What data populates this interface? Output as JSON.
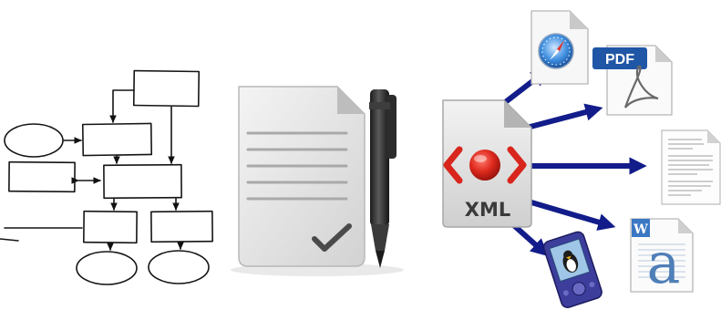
{
  "xml_document": {
    "label": "XML"
  },
  "outputs": {
    "pdf": {
      "badge": "PDF"
    },
    "word": {
      "badge": "W",
      "glyph": "a"
    },
    "text": {}
  },
  "colors": {
    "arrow": "#121c8a",
    "xml_bracket": "#d8261d",
    "pdf_badge": "#1f56a6",
    "word_badge": "#3a78c4",
    "doc_gray": "#d9d9d9",
    "pen": "#2a2a2a"
  },
  "icons": [
    "flowchart-sketch",
    "checked-document-icon",
    "pen-icon",
    "xml-document-icon",
    "safari-html-icon",
    "pdf-document-icon",
    "text-document-icon",
    "word-document-icon",
    "pda-device-icon"
  ]
}
